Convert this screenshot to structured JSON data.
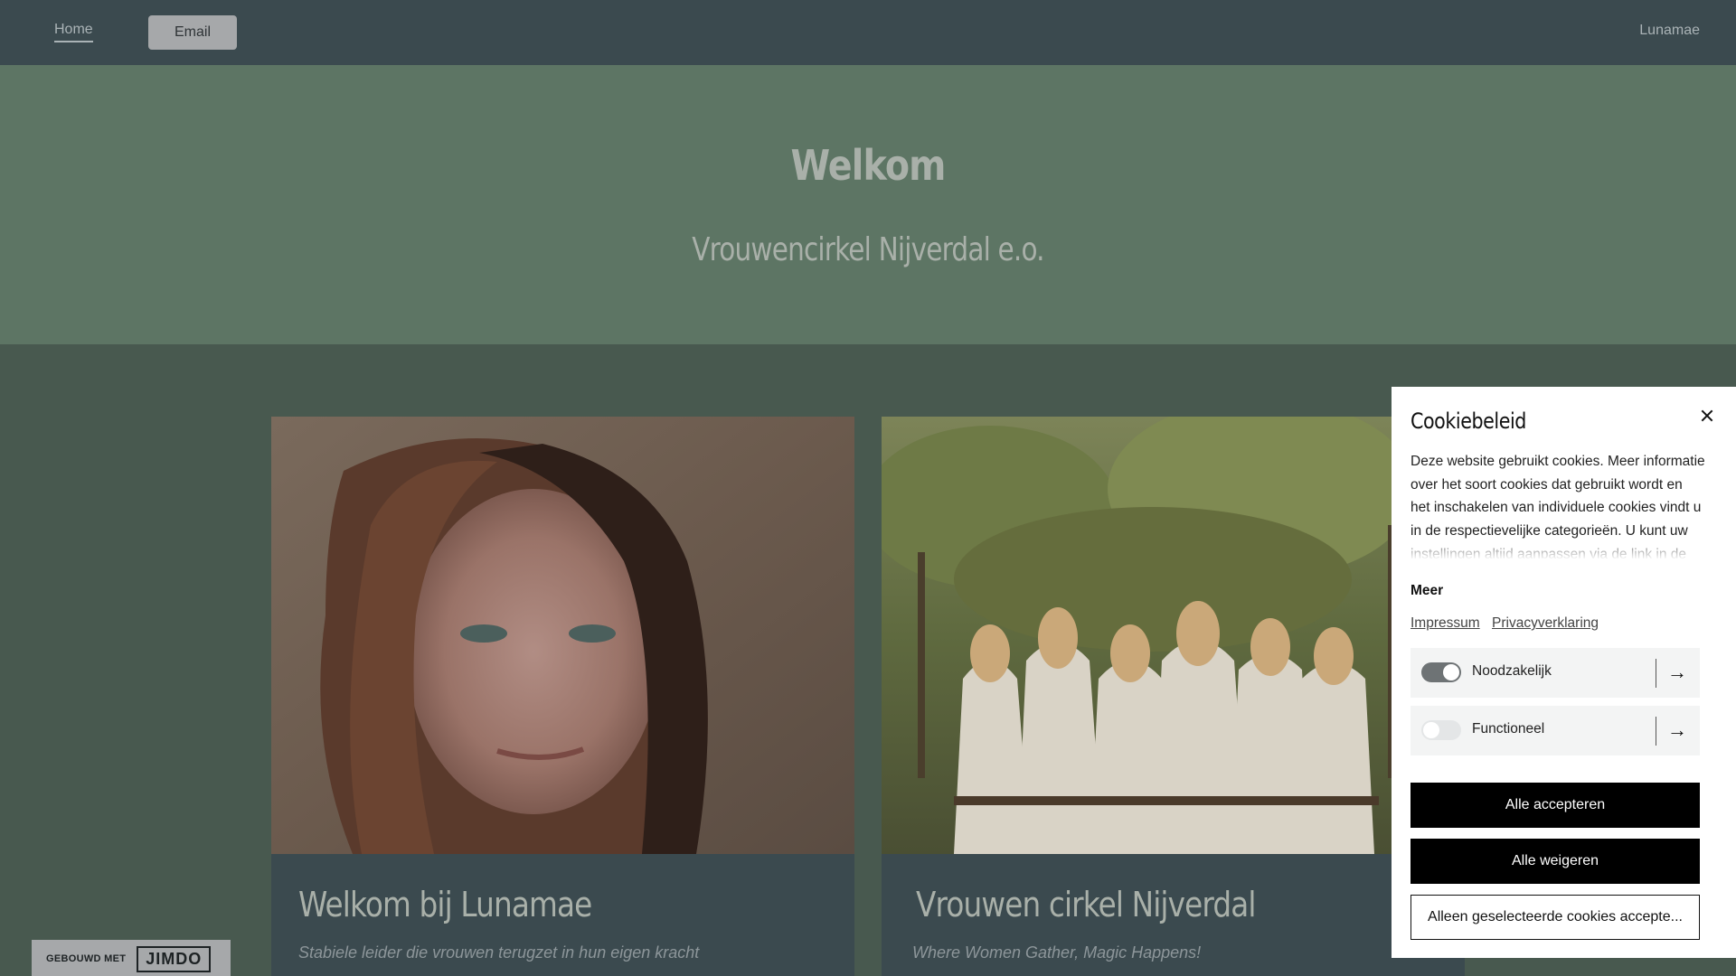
{
  "nav": {
    "home": "Home",
    "email": "Email",
    "brand": "Lunamae"
  },
  "hero": {
    "title": "Welkom",
    "subtitle": "Vrouwencirkel Nijverdal e.o."
  },
  "cards": [
    {
      "title": "Welkom bij Lunamae",
      "subtitle": "Stabiele leider die vrouwen terugzet in hun eigen kracht"
    },
    {
      "title": "Vrouwen cirkel Nijverdal",
      "subtitle": "Where Women Gather, Magic Happens!"
    }
  ],
  "badge": {
    "prefix": "GEBOUWD MET",
    "logo": "JIMDO"
  },
  "cookie": {
    "title": "Cookiebeleid",
    "text": "Deze website gebruikt cookies. Meer informatie over het soort cookies dat gebruikt wordt en het inschakelen van individuele cookies vindt u in de respectievelijke categorieën. U kunt uw instellingen altijd aanpassen via de link in de",
    "more_label": "Meer",
    "links": [
      "Impressum",
      "Privacyverklaring"
    ],
    "categories": [
      {
        "label": "Noodzakelijk",
        "enabled": true
      },
      {
        "label": "Functioneel",
        "enabled": false
      }
    ],
    "accept_all": "Alle accepteren",
    "reject_all": "Alle weigeren",
    "accept_selected": "Alleen geselecteerde cookies accepte..."
  },
  "colors": {
    "nav_bg": "#3b4a4f",
    "hero_bg": "#5d7564",
    "page_bg": "#48594f",
    "card_bg": "#3b4a4f"
  }
}
